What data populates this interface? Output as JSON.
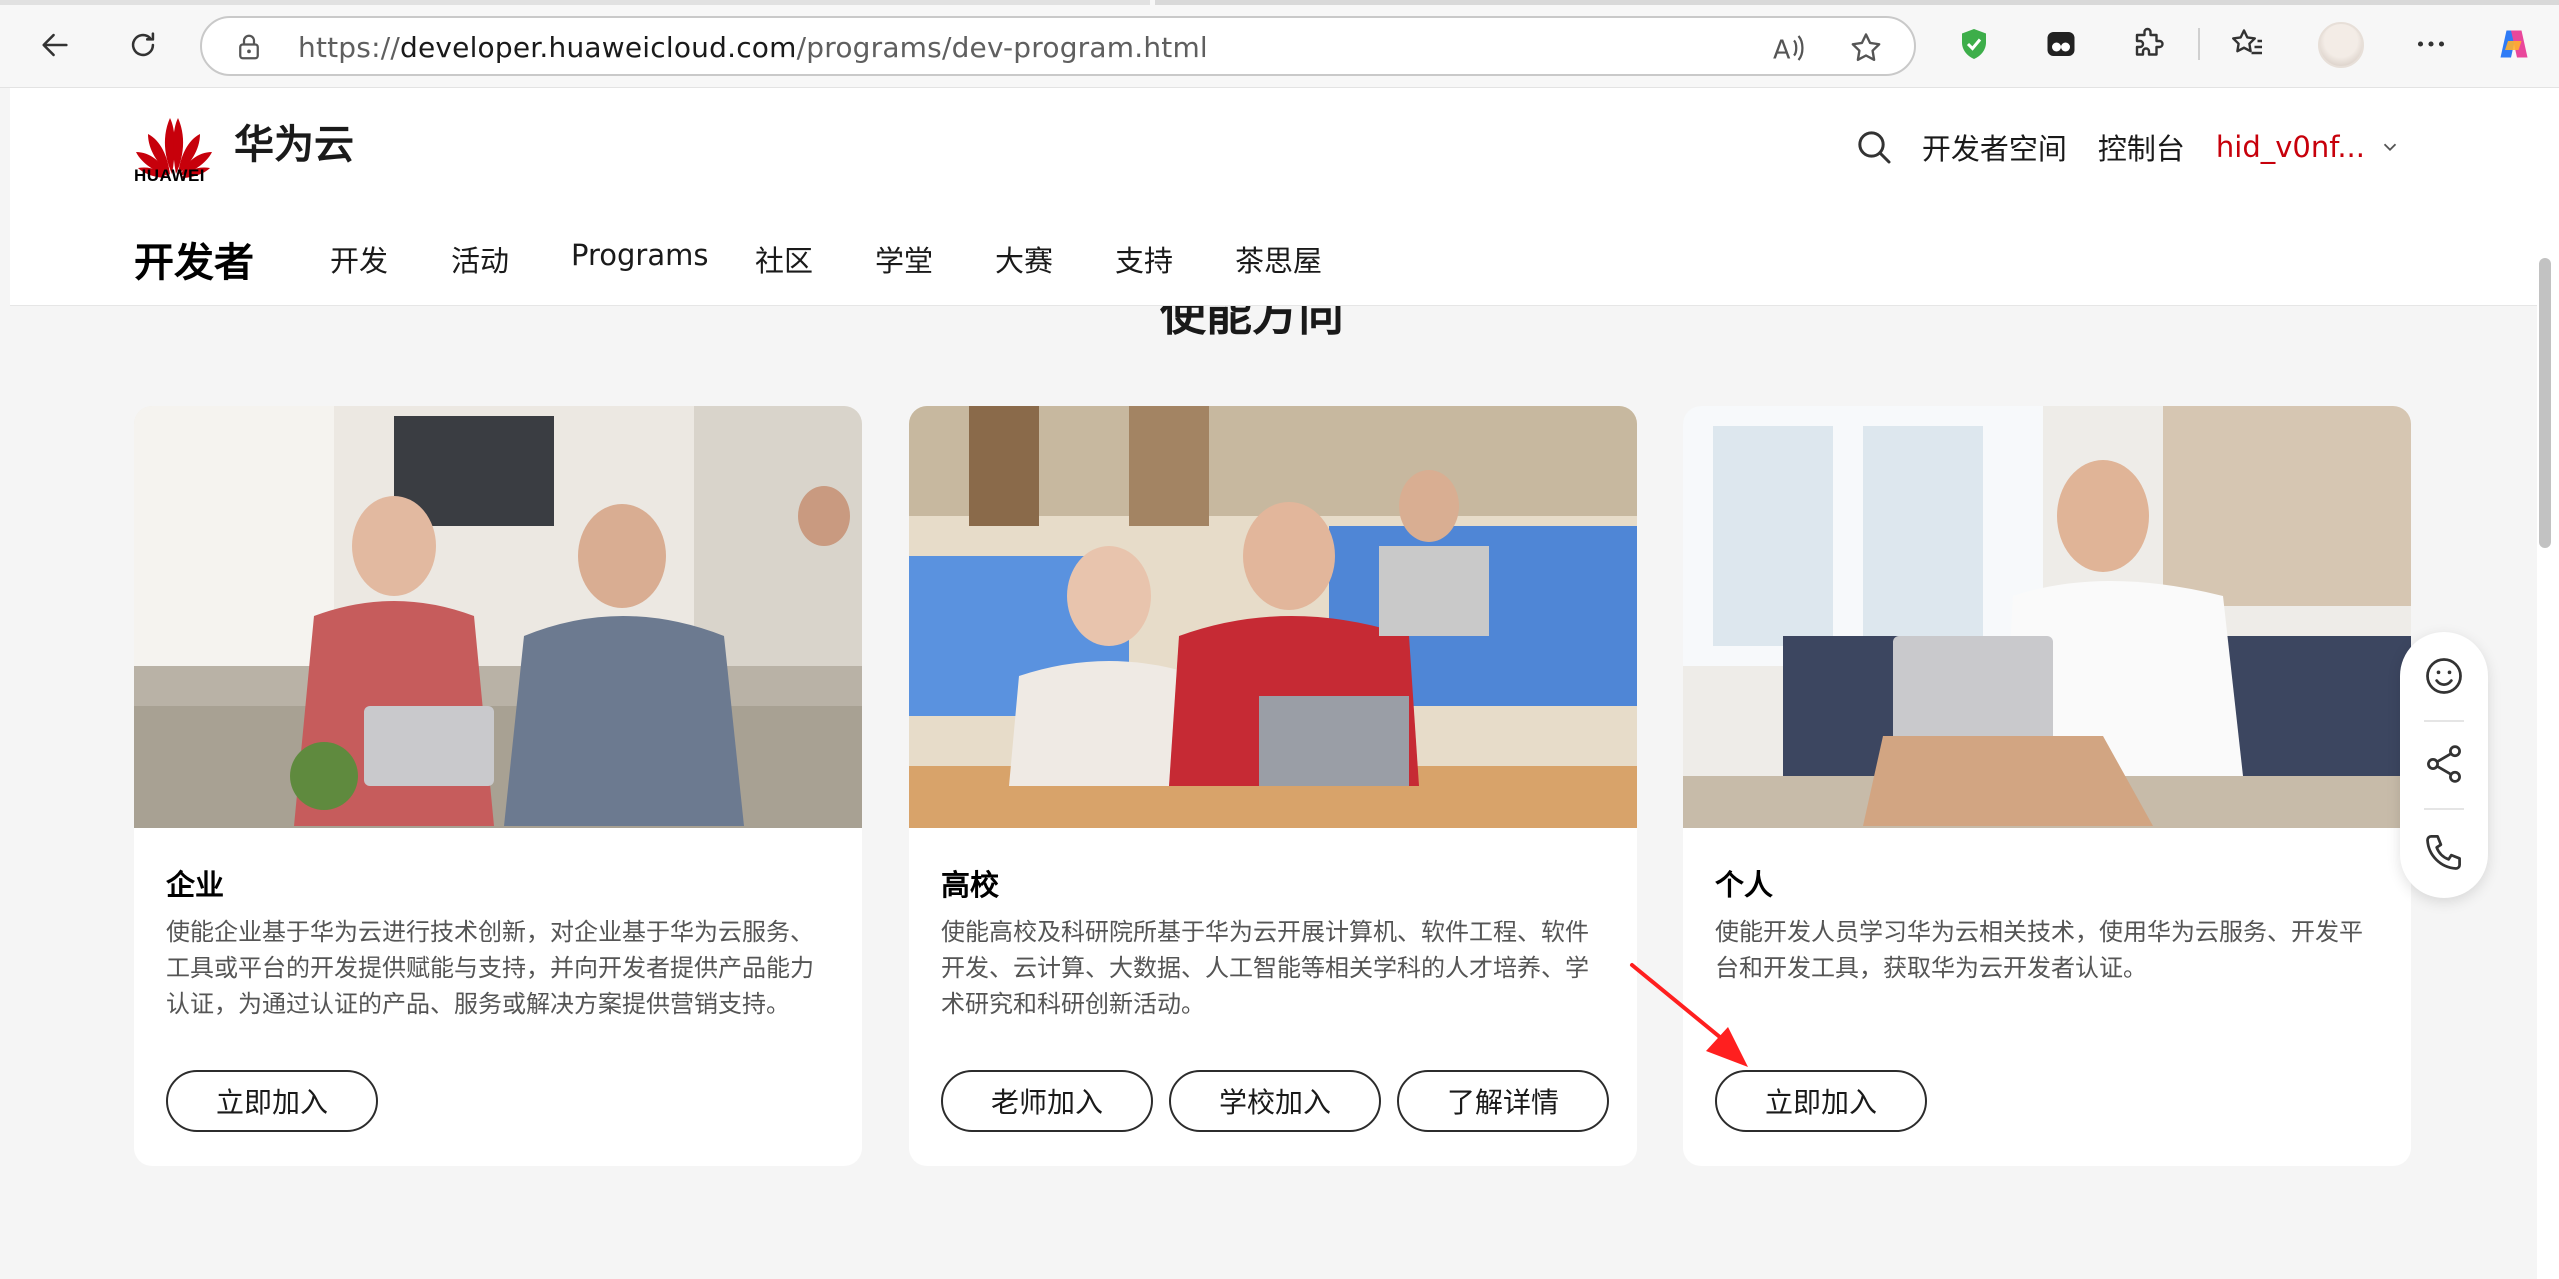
{
  "browser": {
    "url_prefix": "https://",
    "url_host": "developer.huaweicloud.com",
    "url_path": "/programs/dev-program.html"
  },
  "header": {
    "logo_text": "HUAWEI",
    "brand_name": "华为云",
    "search_icon": "search-icon",
    "developer_space": "开发者空间",
    "console": "控制台",
    "user_name": "hid_v0nf..."
  },
  "nav": {
    "section_title": "开发者",
    "items": [
      "开发",
      "活动",
      "Programs",
      "社区",
      "学堂",
      "大赛",
      "支持",
      "茶思屋"
    ]
  },
  "content": {
    "partial_heading": "使能方向",
    "cards": [
      {
        "title": "企业",
        "desc": "使能企业基于华为云进行技术创新，对企业基于华为云服务、工具或平台的开发提供赋能与支持，并向开发者提供产品能力认证，为通过认证的产品、服务或解决方案提供营销支持。",
        "buttons": [
          "立即加入"
        ]
      },
      {
        "title": "高校",
        "desc": "使能高校及科研院所基于华为云开展计算机、软件工程、软件开发、云计算、大数据、人工智能等相关学科的人才培养、学术研究和科研创新活动。",
        "buttons": [
          "老师加入",
          "学校加入",
          "了解详情"
        ]
      },
      {
        "title": "个人",
        "desc": "使能开发人员学习华为云相关技术，使用华为云服务、开发平台和开发工具，获取华为云开发者认证。",
        "buttons": [
          "立即加入"
        ]
      }
    ]
  },
  "float_toolbar": [
    "smile-icon",
    "share-icon",
    "phone-icon"
  ],
  "colors": {
    "brand_red": "#c7000b",
    "annotation_red": "#ff1f1f",
    "page_bg": "#f5f5f5"
  }
}
